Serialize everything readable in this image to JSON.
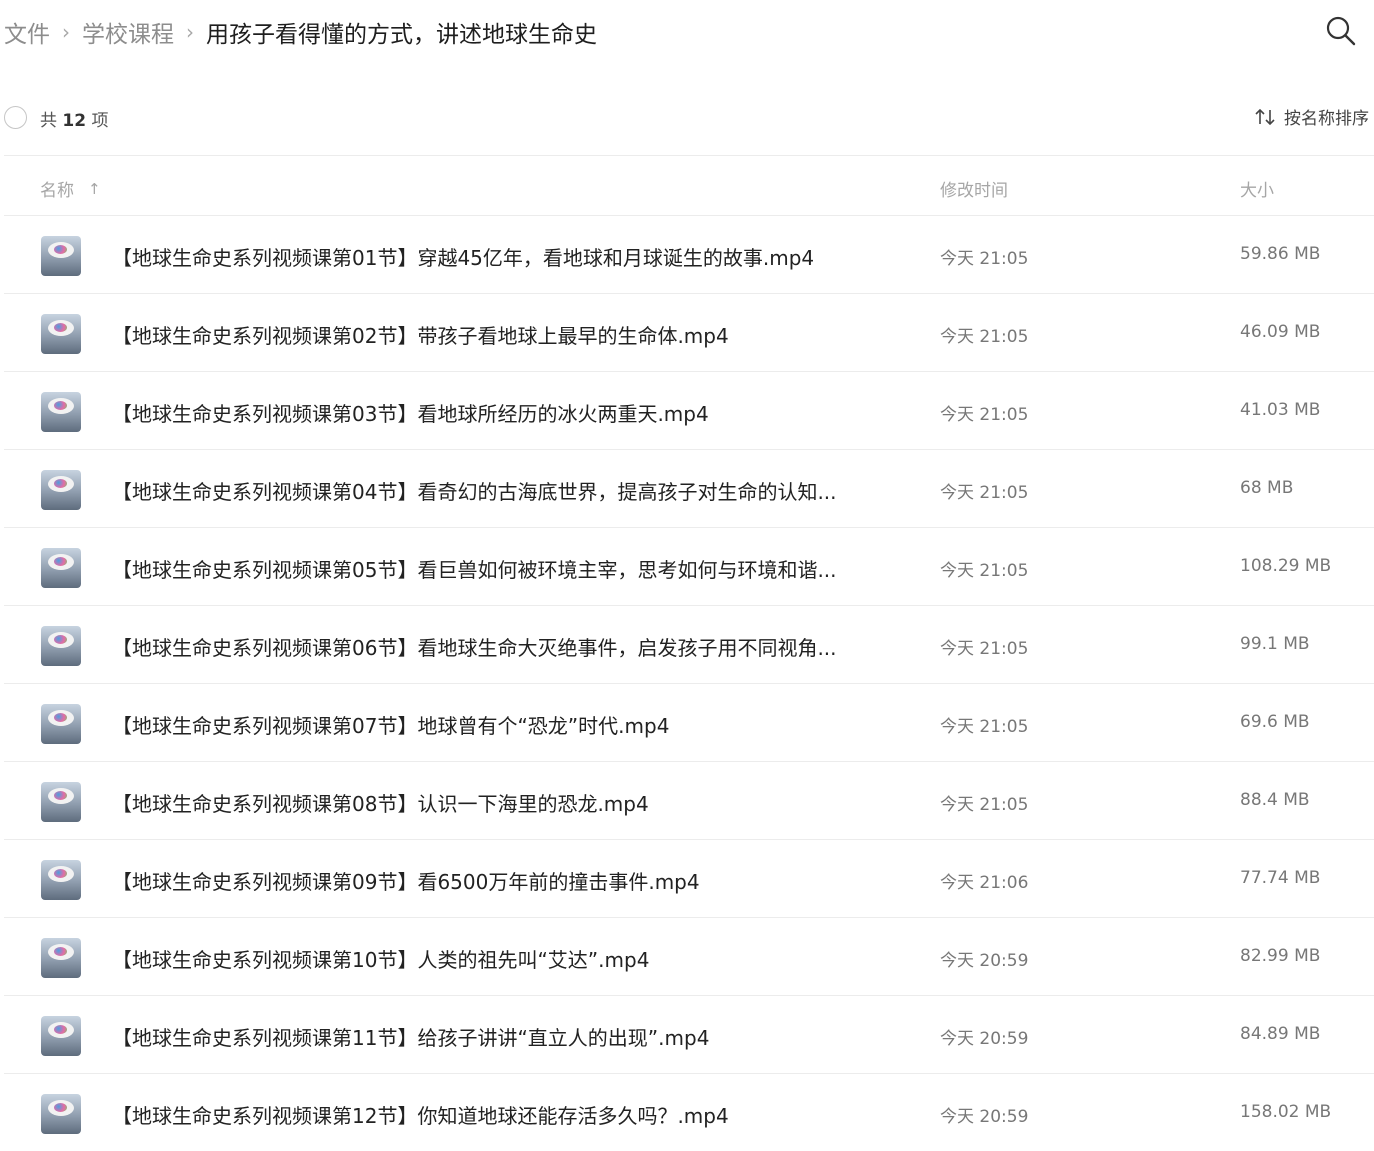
{
  "breadcrumb": {
    "root": "文件",
    "folder": "学校课程",
    "current": "用孩子看得懂的方式，讲述地球生命史"
  },
  "toolbar": {
    "count_prefix": "共",
    "count": "12",
    "count_suffix": "项",
    "sort_label": "按名称排序"
  },
  "icons": {
    "search": "search-icon",
    "sort": "sort-icon",
    "video_thumb": "video-thumbnail-icon"
  },
  "columns": {
    "name": "名称",
    "name_sort_arrow": "↑",
    "modified": "修改时间",
    "size": "大小"
  },
  "files": [
    {
      "name": "【地球生命史系列视频课第01节】穿越45亿年，看地球和月球诞生的故事.mp4",
      "time": "今天 21:05",
      "size": "59.86 MB"
    },
    {
      "name": "【地球生命史系列视频课第02节】带孩子看地球上最早的生命体.mp4",
      "time": "今天 21:05",
      "size": "46.09 MB"
    },
    {
      "name": "【地球生命史系列视频课第03节】看地球所经历的冰火两重天.mp4",
      "time": "今天 21:05",
      "size": "41.03 MB"
    },
    {
      "name": "【地球生命史系列视频课第04节】看奇幻的古海底世界，提高孩子对生命的认知...",
      "time": "今天 21:05",
      "size": "68 MB"
    },
    {
      "name": "【地球生命史系列视频课第05节】看巨兽如何被环境主宰，思考如何与环境和谐...",
      "time": "今天 21:05",
      "size": "108.29 MB"
    },
    {
      "name": "【地球生命史系列视频课第06节】看地球生命大灭绝事件，启发孩子用不同视角...",
      "time": "今天 21:05",
      "size": "99.1 MB"
    },
    {
      "name": "【地球生命史系列视频课第07节】地球曾有个“恐龙”时代.mp4",
      "time": "今天 21:05",
      "size": "69.6 MB"
    },
    {
      "name": "【地球生命史系列视频课第08节】认识一下海里的恐龙.mp4",
      "time": "今天 21:05",
      "size": "88.4 MB"
    },
    {
      "name": "【地球生命史系列视频课第09节】看6500万年前的撞击事件.mp4",
      "time": "今天 21:06",
      "size": "77.74 MB"
    },
    {
      "name": "【地球生命史系列视频课第10节】人类的祖先叫“艾达”.mp4",
      "time": "今天 20:59",
      "size": "82.99 MB"
    },
    {
      "name": "【地球生命史系列视频课第11节】给孩子讲讲“直立人的出现”.mp4",
      "time": "今天 20:59",
      "size": "84.89 MB"
    },
    {
      "name": "【地球生命史系列视频课第12节】你知道地球还能存活多久吗？.mp4",
      "time": "今天 20:59",
      "size": "158.02 MB"
    }
  ]
}
